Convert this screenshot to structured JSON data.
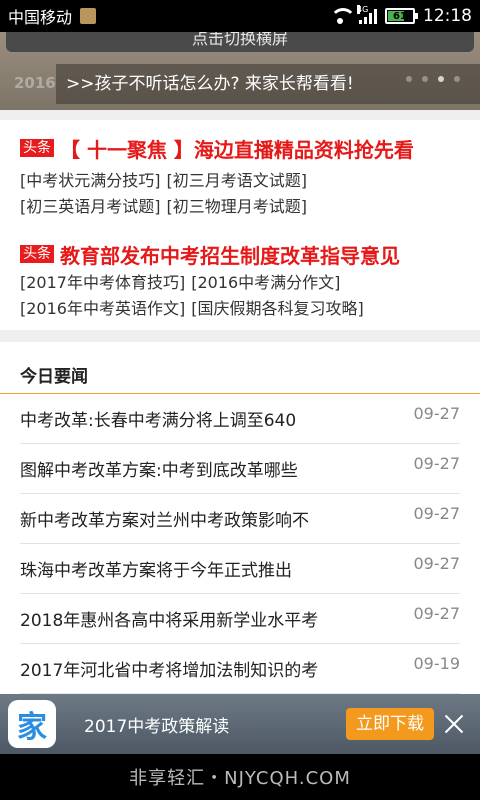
{
  "status_bar": {
    "carrier": "中国移动",
    "network_type": "4G",
    "battery_level": "61",
    "time": "12:18"
  },
  "banner": {
    "switch_button": "点击切换横屏",
    "ghost_text": "2016",
    "ticker_text": ">>孩子不听话怎么办? 来家长帮看看!"
  },
  "headlines": [
    {
      "tag": "头条",
      "title": "【 十一聚焦 】海边直播精品资料抢先看",
      "links": [
        [
          "[中考状元满分技巧]",
          "[初三月考语文试题]"
        ],
        [
          "[初三英语月考试题]",
          "[初三物理月考试题]"
        ]
      ]
    },
    {
      "tag": "头条",
      "title": "教育部发布中考招生制度改革指导意见",
      "links": [
        [
          "[2017年中考体育技巧]",
          "[2016中考满分作文]"
        ],
        [
          "[2016年中考英语作文]",
          "[国庆假期各科复习攻略]"
        ]
      ]
    }
  ],
  "today_news": {
    "section_title": "今日要闻",
    "items": [
      {
        "title": "中考改革:长春中考满分将上调至640",
        "date": "09-27"
      },
      {
        "title": "图解中考改革方案:中考到底改革哪些",
        "date": "09-27"
      },
      {
        "title": "新中考改革方案对兰州中考政策影响不",
        "date": "09-27"
      },
      {
        "title": "珠海中考改革方案将于今年正式推出",
        "date": "09-27"
      },
      {
        "title": "2018年惠州各高中将采用新学业水平考",
        "date": "09-27"
      },
      {
        "title": "2017年河北省中考将增加法制知识的考",
        "date": "09-19"
      }
    ]
  },
  "ad_bar": {
    "app_icon_glyph": "家",
    "text": "2017中考政策解读",
    "download_button": "立即下载"
  },
  "watermark": "非享轻汇・NJYCQH.COM",
  "colors": {
    "headline_red": "#e61919",
    "accent_orange": "#f39a1e",
    "section_rule": "#f0a040"
  }
}
